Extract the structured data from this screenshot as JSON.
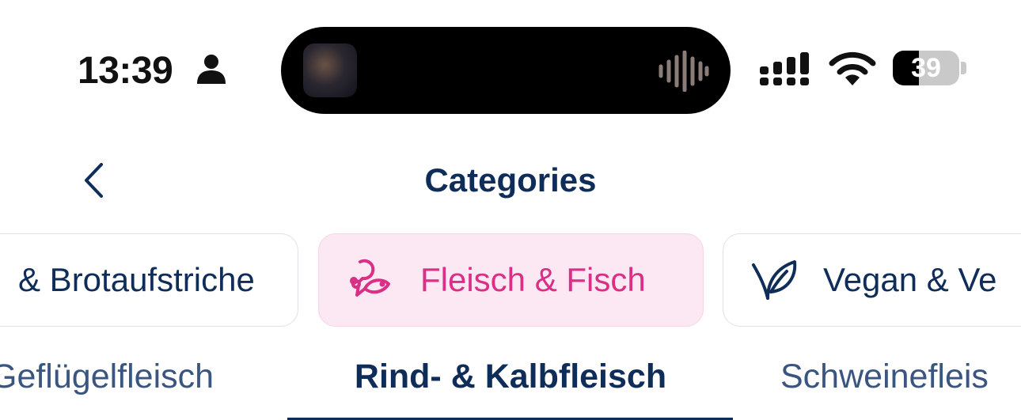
{
  "status_bar": {
    "time": "13:39",
    "battery": "39",
    "battery_level": 0.39
  },
  "header": {
    "title": "Categories"
  },
  "categories": [
    {
      "label": "& Brotaufstriche",
      "selected": false
    },
    {
      "label": "Fleisch & Fisch",
      "icon": "meat-fish-icon",
      "selected": true
    },
    {
      "label": "Vegan & Ve",
      "icon": "leaf-icon",
      "selected": false
    }
  ],
  "subcategories": [
    {
      "label": "Geflügelfleisch",
      "selected": false
    },
    {
      "label": "Rind- & Kalbfleisch",
      "selected": true
    },
    {
      "label": "Schweinefleis",
      "selected": false
    }
  ],
  "colors": {
    "brand_navy": "#0f2d59",
    "accent_pink": "#d92f86",
    "selected_chip_bg": "#fce8f2"
  }
}
